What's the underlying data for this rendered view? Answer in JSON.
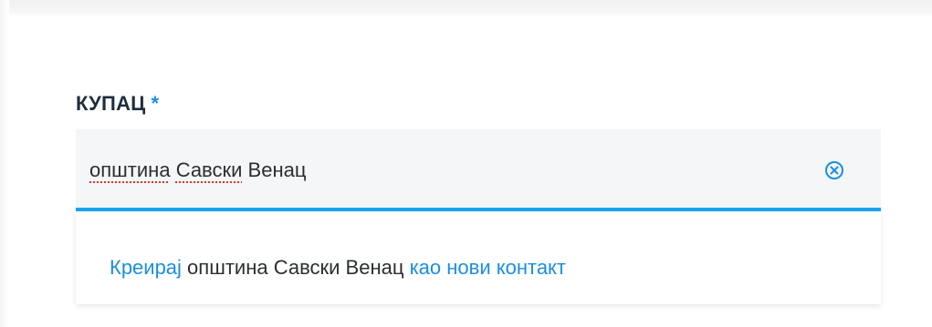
{
  "field": {
    "label": "КУПАЦ",
    "required_mark": "*"
  },
  "input": {
    "value_part1": "општина",
    "value_space1": " ",
    "value_part2": "Савски",
    "value_rest": " Венац"
  },
  "dropdown": {
    "create_action": "Креирај",
    "entity_name": " општина Савски Венац ",
    "as_new_contact": "као нови контакт"
  },
  "icons": {
    "clear": "close-circle-icon"
  },
  "colors": {
    "accent": "#1a8fe3",
    "underline": "#1aa3f0",
    "label": "#1f2d3d",
    "input_bg": "#f4f6f7",
    "spellcheck": "#e0332f"
  }
}
